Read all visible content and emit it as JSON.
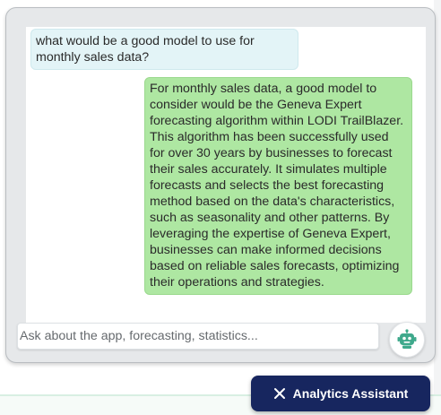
{
  "conversation": {
    "messages": [
      {
        "role": "user",
        "text": "what would be a good model to use for monthly sales data?"
      },
      {
        "role": "assistant",
        "text": "For monthly sales data, a good model to consider would be the Geneva Expert forecasting algorithm within LODI TrailBlazer. This algorithm has been successfully used for over 30 years by businesses to forecast their sales accurately. It simulates multiple forecasts and selects the best forecasting method based on the data's characteristics, such as seasonality and other patterns. By leveraging the expertise of Geneva Expert, businesses can make informed decisions based on reliable sales forecasts, optimizing their operations and strategies."
      }
    ]
  },
  "composer": {
    "placeholder": "Ask about the app, forecasting, statistics...",
    "value": "",
    "send_icon": "robot-icon"
  },
  "assistant_toggle": {
    "label": "Analytics Assistant",
    "icon": "close-icon"
  },
  "colors": {
    "user_bubble": "#e3f4f7",
    "assistant_bubble": "#aee7a2",
    "robot_accent": "#3fa98c",
    "toggle_bg": "#17265f"
  }
}
